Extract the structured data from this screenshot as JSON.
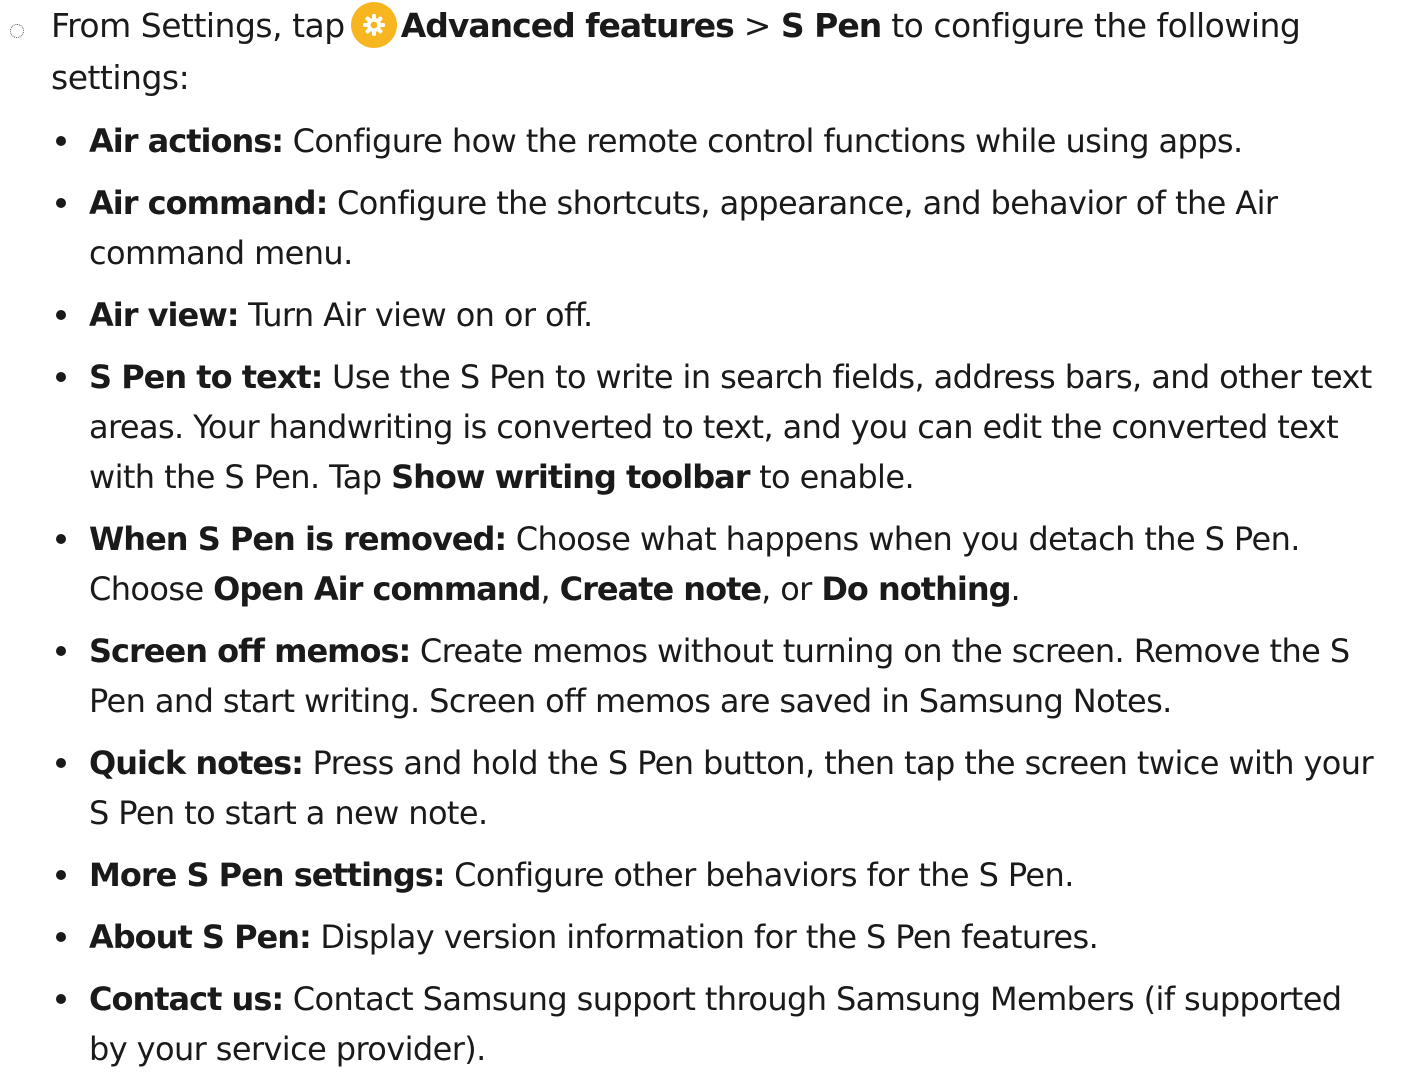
{
  "intro": {
    "prefix": "From Settings, tap",
    "icon": "gear-icon",
    "icon_color": "#f7b61f",
    "path_1": "Advanced features",
    "separator": " > ",
    "path_2": "S Pen",
    "suffix": " to configure the following settings:"
  },
  "items": [
    {
      "title": "Air actions:",
      "text": " Configure how the remote control functions while using apps."
    },
    {
      "title": "Air command:",
      "text": " Configure the shortcuts, appearance, and behavior of the Air command menu."
    },
    {
      "title": "Air view:",
      "text": " Turn Air view on or off."
    },
    {
      "title": "S Pen to text:",
      "text": " Use the S Pen to write in search fields, address bars, and other text areas. Your handwriting is converted to text, and you can edit the converted text with the S Pen. Tap ",
      "bold_2": "Show writing toolbar",
      "text_2": " to enable."
    },
    {
      "title": "When S Pen is removed:",
      "text": " Choose what happens when you detach the S Pen. Choose ",
      "bold_2": "Open Air command",
      "text_2": ", ",
      "bold_3": "Create note",
      "text_3": ", or ",
      "bold_4": "Do nothing",
      "text_4": "."
    },
    {
      "title": "Screen off memos:",
      "text": " Create memos without turning on the screen. Remove the S Pen and start writing. Screen off memos are saved in Samsung Notes."
    },
    {
      "title": "Quick notes:",
      "text": " Press and hold the S Pen button, then tap the screen twice with your S Pen to start a new note."
    },
    {
      "title": "More S Pen settings:",
      "text": " Configure other behaviors for the S Pen."
    },
    {
      "title": "About S Pen:",
      "text": " Display version information for the S Pen features."
    },
    {
      "title": "Contact us:",
      "text": " Contact Samsung support through Samsung Members (if supported by your service provider)."
    }
  ]
}
